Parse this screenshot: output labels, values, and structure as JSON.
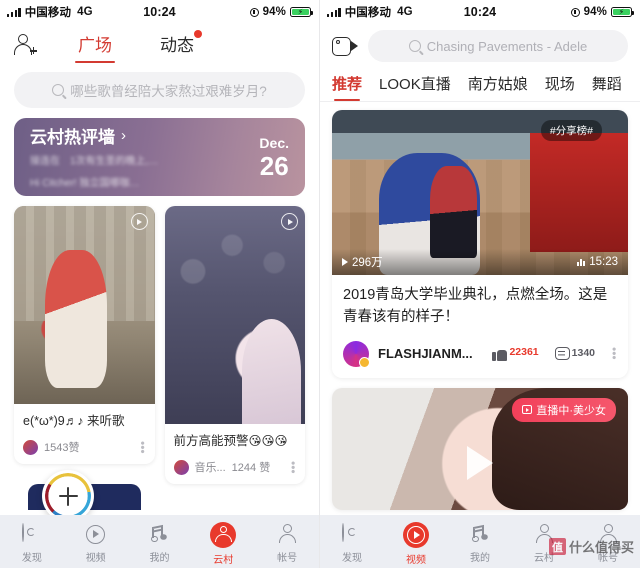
{
  "status_bar": {
    "carrier": "中国移动",
    "network": "4G",
    "time": "10:24",
    "battery": "94%",
    "signal_icon": "signal-bars-icon",
    "battery_icon": "battery-charging-icon",
    "location_icon": "location-icon"
  },
  "left_phone": {
    "header": {
      "add_friend_icon": "add-friend-icon",
      "tabs": [
        {
          "label": "广场",
          "active": true
        },
        {
          "label": "动态",
          "active": false,
          "badge": true
        }
      ]
    },
    "search": {
      "placeholder": "哪些歌曾经陪大家熬过艰难岁月?",
      "icon": "search-icon"
    },
    "banner": {
      "title": "云村热评墙",
      "chevron": "›",
      "subtext_line1": "接连在　1次有生圣的晚上,…",
      "subtext_line2": "Hi  Citcher!  独立国哪咖…",
      "month": "Dec.",
      "day": "26"
    },
    "cards": [
      {
        "caption": "e(*ω*)9♬♪ 来听歌",
        "likes": "1543赞",
        "play_icon": "play-circle-icon",
        "menu_icon": "kebab-menu-icon"
      },
      {
        "caption": "前方高能预警😘😘😘",
        "author": "音乐...",
        "likes": "1244 赞",
        "play_icon": "play-circle-icon",
        "menu_icon": "kebab-menu-icon"
      }
    ],
    "fab": {
      "icon": "plus-icon",
      "label": "+"
    },
    "nav": [
      {
        "label": "发现",
        "icon": "discover-disc-icon",
        "active": false
      },
      {
        "label": "视频",
        "icon": "video-play-icon",
        "active": false
      },
      {
        "label": "我的",
        "icon": "music-note-icon",
        "active": false
      },
      {
        "label": "云村",
        "icon": "cloud-village-people-icon",
        "active": true
      },
      {
        "label": "帐号",
        "icon": "account-person-icon",
        "active": false
      }
    ]
  },
  "right_phone": {
    "header": {
      "camera_icon": "video-camera-icon",
      "search": {
        "placeholder": "Chasing Pavements - Adele",
        "icon": "search-icon"
      }
    },
    "tabs": [
      {
        "label": "推荐",
        "active": true
      },
      {
        "label": "LOOK直播",
        "active": false
      },
      {
        "label": "南方姑娘",
        "active": false
      },
      {
        "label": "现场",
        "active": false
      },
      {
        "label": "舞蹈",
        "active": false
      }
    ],
    "video_card": {
      "share_badge": "#分享榜#",
      "views": "296万",
      "duration": "15:23",
      "title": "2019青岛大学毕业典礼，点燃全场。这是青春该有的样子！",
      "author": "FLASHJIANM...",
      "likes": "22361",
      "comments": "1340",
      "like_icon": "thumbs-up-icon",
      "comment_icon": "comment-icon",
      "menu_icon": "kebab-menu-icon",
      "play_icon": "play-triangle-icon",
      "quality_icon": "quality-bars-icon"
    },
    "live_card": {
      "badge": "直播中·美少女",
      "badge_icon": "live-camera-icon",
      "play_icon": "play-triangle-icon"
    },
    "nav": [
      {
        "label": "发现",
        "icon": "discover-disc-icon",
        "active": false
      },
      {
        "label": "视频",
        "icon": "video-play-icon",
        "active": true
      },
      {
        "label": "我的",
        "icon": "music-note-icon",
        "active": false
      },
      {
        "label": "云村",
        "icon": "cloud-village-people-icon",
        "active": false
      },
      {
        "label": "帐号",
        "icon": "account-person-icon",
        "active": false
      }
    ],
    "watermark": {
      "mark": "值",
      "text": "什么值得买"
    }
  },
  "colors": {
    "accent_red": "#e8392c",
    "tab_red": "#d33a31",
    "battery_green": "#3ad15f"
  }
}
